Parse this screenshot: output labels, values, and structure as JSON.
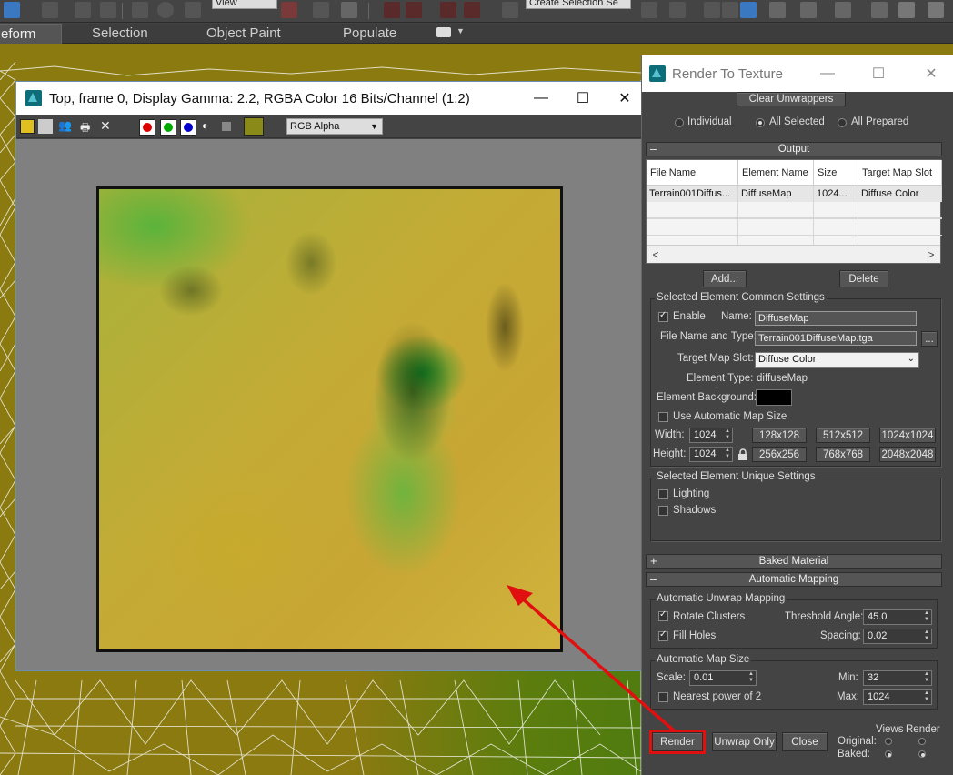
{
  "toolbar": {
    "view_dropdown": "View",
    "selection_dropdown": "Create Selection Se"
  },
  "ribbon": {
    "tabs": [
      {
        "label": "eform",
        "active": true
      },
      {
        "label": "Selection"
      },
      {
        "label": "Object Paint"
      },
      {
        "label": "Populate"
      }
    ]
  },
  "framebuffer": {
    "title": "Top, frame 0, Display Gamma: 2.2, RGBA Color 16 Bits/Channel (1:2)",
    "channel_select": "RGB Alpha",
    "swatch_color": "#8a8a18"
  },
  "rtt": {
    "title": "Render To Texture",
    "clear_unwrappers": "Clear Unwrappers",
    "radio_options": [
      "Individual",
      "All Selected",
      "All Prepared"
    ],
    "radio_selected": 1,
    "output_rollout": "Output",
    "table": {
      "headers": [
        "File Name",
        "Element Name",
        "Size",
        "Target Map Slot"
      ],
      "rows": [
        [
          "Terrain001Diffus...",
          "DiffuseMap",
          "1024...",
          "Diffuse Color"
        ]
      ]
    },
    "add_button": "Add...",
    "delete_button": "Delete",
    "common_group": "Selected Element Common Settings",
    "enable_label": "Enable",
    "name_label": "Name:",
    "name_value": "DiffuseMap",
    "file_label": "File Name and Type:",
    "file_value": "Terrain001DiffuseMap.tga",
    "browse_button": "...",
    "target_slot_label": "Target Map Slot:",
    "target_slot_value": "Diffuse Color",
    "element_type_label": "Element Type:",
    "element_type_value": "diffuseMap",
    "element_bg_label": "Element Background:",
    "auto_map_size_label": "Use Automatic Map Size",
    "width_label": "Width:",
    "width_value": "1024",
    "height_label": "Height:",
    "height_value": "1024",
    "size_presets": [
      "128x128",
      "512x512",
      "1024x1024",
      "256x256",
      "768x768",
      "2048x2048"
    ],
    "unique_group": "Selected Element Unique Settings",
    "lighting_label": "Lighting",
    "shadows_label": "Shadows",
    "baked_material_rollout": "Baked Material",
    "auto_mapping_rollout": "Automatic Mapping",
    "auto_unwrap_group": "Automatic Unwrap Mapping",
    "rotate_clusters": "Rotate Clusters",
    "threshold_label": "Threshold Angle:",
    "threshold_value": "45.0",
    "fill_holes": "Fill Holes",
    "spacing_label": "Spacing:",
    "spacing_value": "0.02",
    "auto_map_size_group": "Automatic Map Size",
    "scale_label": "Scale:",
    "scale_value": "0.01",
    "min_label": "Min:",
    "min_value": "32",
    "nearest_power": "Nearest power of 2",
    "max_label": "Max:",
    "max_value": "1024",
    "render_button": "Render",
    "unwrap_only_button": "Unwrap Only",
    "close_button": "Close",
    "views_label": "Views",
    "render_label": "Render",
    "original_label": "Original:",
    "baked_label": "Baked:"
  },
  "annotation": {
    "arrow_color": "#e01010"
  }
}
